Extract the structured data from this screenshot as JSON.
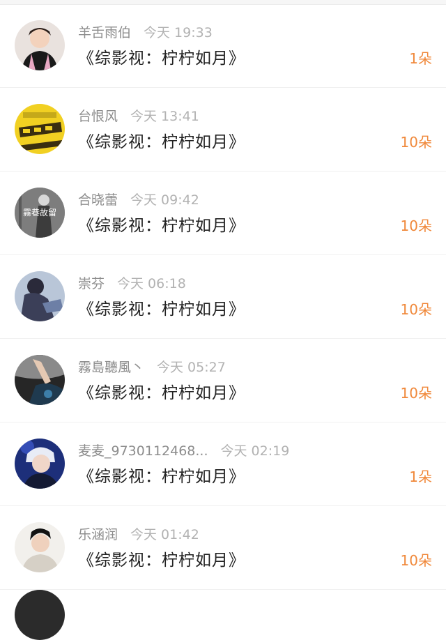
{
  "gift_list": {
    "entries": [
      {
        "user": "羊舌雨伯",
        "time": "今天 19:33",
        "title": "《综影视：柠柠如月》",
        "amount": "1朵",
        "avatar": "avatar-singer-pink-jacket"
      },
      {
        "user": "台恨风",
        "time": "今天 13:41",
        "title": "《综影视：柠柠如月》",
        "amount": "10朵",
        "avatar": "avatar-yellow-cartoon"
      },
      {
        "user": "合晓蕾",
        "time": "今天 09:42",
        "title": "《综影视：柠柠如月》",
        "amount": "10朵",
        "avatar": "avatar-gray-figure-with-text"
      },
      {
        "user": "崇芬",
        "time": "今天 06:18",
        "title": "《综影视：柠柠如月》",
        "amount": "10朵",
        "avatar": "avatar-dark-figure-blue"
      },
      {
        "user": "霧島聽風丶",
        "time": "今天 05:27",
        "title": "《综影视：柠柠如月》",
        "amount": "10朵",
        "avatar": "avatar-hand-on-dark"
      },
      {
        "user": "麦麦_9730112468...",
        "time": "今天 02:19",
        "title": "《综影视：柠柠如月》",
        "amount": "1朵",
        "avatar": "avatar-blonde-blue"
      },
      {
        "user": "乐涵润",
        "time": "今天 01:42",
        "title": "《综影视：柠柠如月》",
        "amount": "10朵",
        "avatar": "avatar-boy-light-sweater"
      }
    ],
    "avatar_text_3": "霧巷故留"
  },
  "colors": {
    "amount": "#f0883a",
    "username": "#8d8d8d",
    "time": "#b2b2b2",
    "title": "#222222"
  }
}
